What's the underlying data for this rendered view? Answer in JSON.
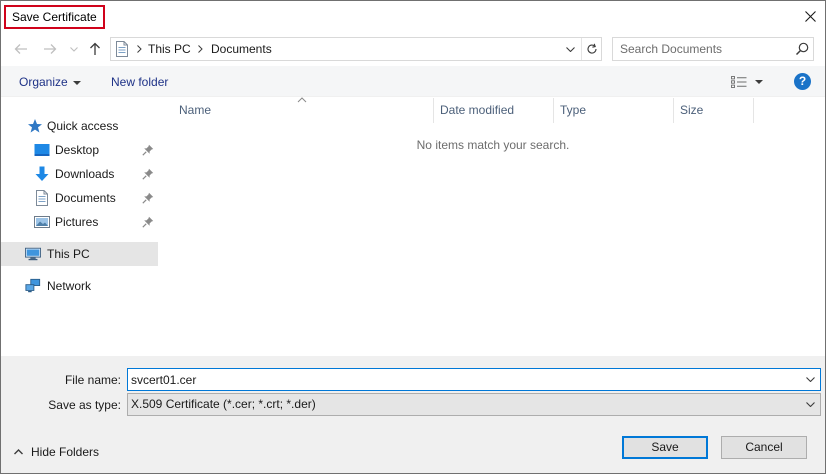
{
  "window": {
    "title": "Save Certificate"
  },
  "address": {
    "crumbs": [
      "This PC",
      "Documents"
    ]
  },
  "search": {
    "placeholder": "Search Documents"
  },
  "toolbar": {
    "organize_label": "Organize",
    "new_folder_label": "New folder",
    "help_label": "?"
  },
  "sidebar": {
    "items": [
      {
        "label": "Quick access",
        "icon": "star-icon"
      },
      {
        "label": "Desktop",
        "icon": "desktop-folder-icon",
        "pinned": true
      },
      {
        "label": "Downloads",
        "icon": "download-arrow-icon",
        "pinned": true
      },
      {
        "label": "Documents",
        "icon": "document-icon",
        "pinned": true
      },
      {
        "label": "Pictures",
        "icon": "pictures-icon",
        "pinned": true
      },
      {
        "label": "This PC",
        "icon": "computer-icon",
        "selected": true
      },
      {
        "label": "Network",
        "icon": "network-icon"
      }
    ]
  },
  "filelist": {
    "columns": [
      "Name",
      "Date modified",
      "Type",
      "Size"
    ],
    "empty_message": "No items match your search."
  },
  "form": {
    "file_name_label": "File name:",
    "file_name_value": "svcert01.cer",
    "save_as_type_label": "Save as type:",
    "save_as_type_value": "X.509 Certificate (*.cer; *.crt; *.der)"
  },
  "footer": {
    "hide_folders_label": "Hide Folders",
    "save_label": "Save",
    "cancel_label": "Cancel"
  },
  "colors": {
    "accent": "#0078d7",
    "title_highlight": "#d0021b",
    "link": "#1e3287",
    "selection": "#e5e5e5"
  }
}
